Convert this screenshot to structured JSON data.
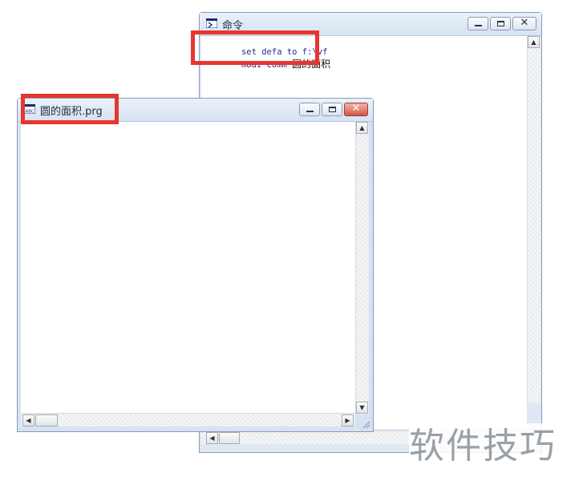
{
  "command_window": {
    "title": "命令",
    "lines": [
      {
        "code": "set defa to f:\\vf",
        "suffix": ""
      },
      {
        "code": "modi comm ",
        "suffix": "圆的面积"
      }
    ]
  },
  "editor_window": {
    "title": "圆的面积.prg"
  },
  "watermark": "软件技巧",
  "colors": {
    "highlight": "#e8352f",
    "code_text": "#1f2f8f",
    "close_button": "#d0584a"
  }
}
